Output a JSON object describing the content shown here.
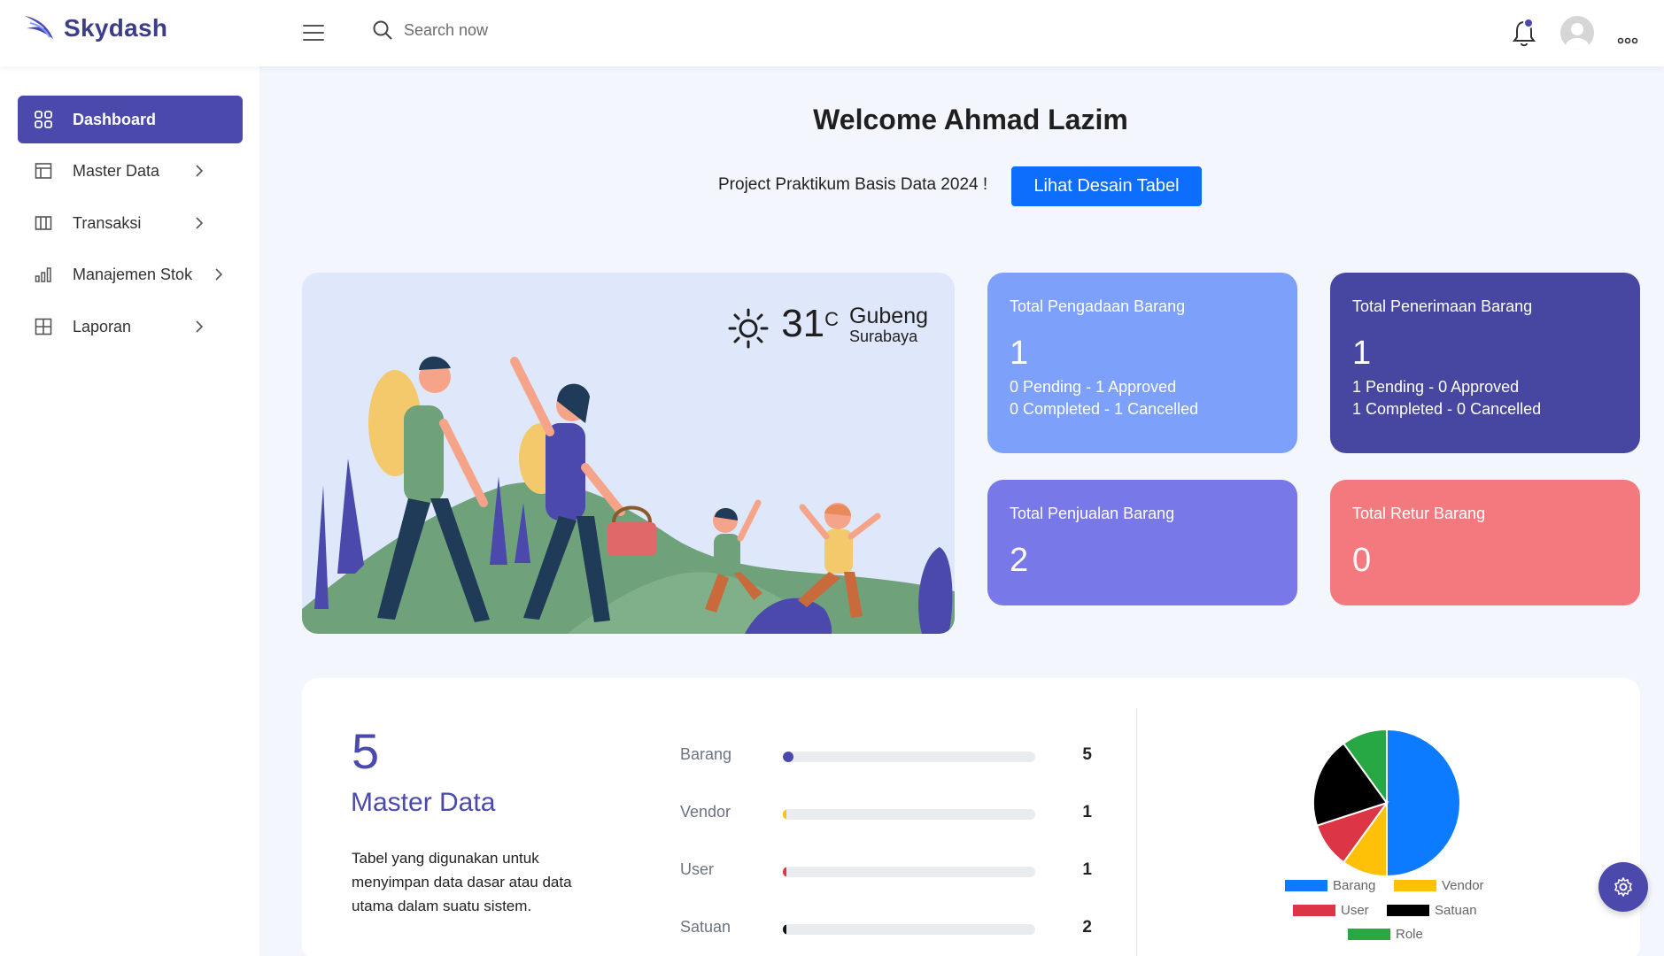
{
  "brand": {
    "name": "Skydash"
  },
  "search": {
    "placeholder": "Search now"
  },
  "sidebar": {
    "items": [
      {
        "label": "Dashboard",
        "icon": "grid-icon",
        "active": true
      },
      {
        "label": "Master Data",
        "icon": "layout-icon"
      },
      {
        "label": "Transaksi",
        "icon": "columns-icon"
      },
      {
        "label": "Manajemen Stok",
        "icon": "bar-chart-icon"
      },
      {
        "label": "Laporan",
        "icon": "table-grid-icon"
      }
    ]
  },
  "main": {
    "welcome": "Welcome Ahmad Lazim",
    "subtitle": "Project Praktikum Basis Data 2024 !",
    "cta_label": "Lihat Desain Tabel"
  },
  "weather": {
    "temp": "31",
    "unit": "C",
    "city": "Gubeng",
    "region": "Surabaya"
  },
  "cards": [
    {
      "title": "Total Pengadaan Barang",
      "value": "1",
      "line1": "0 Pending - 1 Approved",
      "line2": "0 Completed - 1 Cancelled",
      "color": "#7da0fa"
    },
    {
      "title": "Total Penerimaan Barang",
      "value": "1",
      "line1": "1 Pending - 0 Approved",
      "line2": "1 Completed - 0 Cancelled",
      "color": "#4747a1"
    },
    {
      "title": "Total Penjualan Barang",
      "value": "2",
      "color": "#7978e9"
    },
    {
      "title": "Total Retur Barang",
      "value": "0",
      "color": "#f3797e"
    }
  ],
  "master": {
    "count": "5",
    "title": "Master Data",
    "description": "Tabel yang digunakan untuk menyimpan data dasar atau data utama dalam suatu sistem."
  },
  "progress": [
    {
      "label": "Barang",
      "value": "5",
      "fraction": 0.02,
      "color": "#4b49ac"
    },
    {
      "label": "Vendor",
      "value": "1",
      "fraction": 0.01,
      "color": "#ffc107"
    },
    {
      "label": "User",
      "value": "1",
      "fraction": 0.01,
      "color": "#dc3545"
    },
    {
      "label": "Satuan",
      "value": "2",
      "fraction": 0.01,
      "color": "#111111"
    }
  ],
  "chart_data": {
    "type": "pie",
    "categories": [
      "Barang",
      "Vendor",
      "User",
      "Satuan",
      "Role"
    ],
    "values": [
      5,
      1,
      1,
      2,
      1
    ],
    "colors": [
      "#0d7bff",
      "#ffc107",
      "#dc3545",
      "#000000",
      "#28a745"
    ],
    "legend": "bottom"
  }
}
